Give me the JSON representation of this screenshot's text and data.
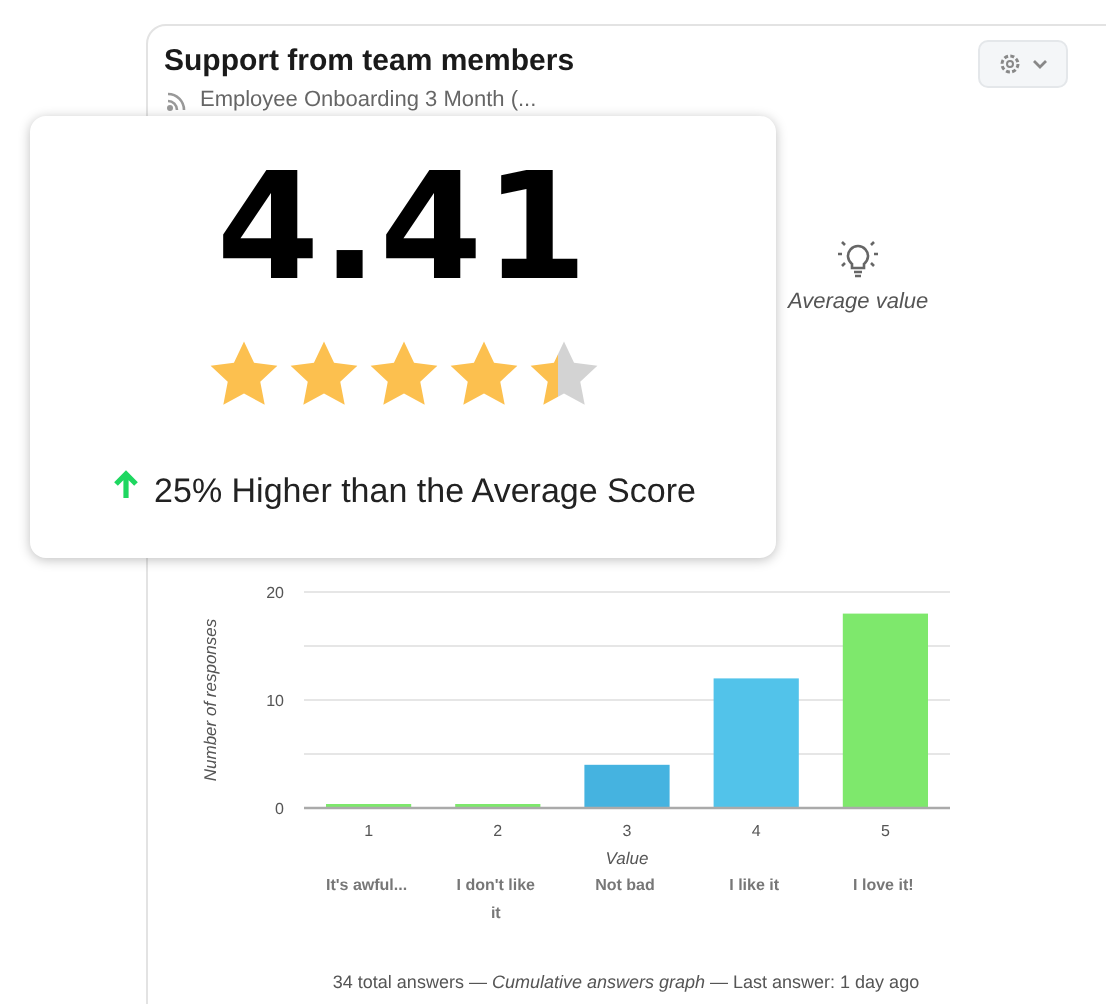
{
  "widget": {
    "title": "Support from team members",
    "source": "Employee Onboarding 3 Month (...",
    "average_label": "Average value"
  },
  "score": {
    "value": "4.41",
    "stars": 4.41,
    "higher": true,
    "comparison": "25% Higher than the Average Score"
  },
  "chart": {
    "chart_data": {
      "type": "bar",
      "xlabel": "Value",
      "ylabel": "Number of responses",
      "categories": [
        "1",
        "2",
        "3",
        "4",
        "5"
      ],
      "series": [
        {
          "color": "#7ee86c",
          "values": [
            0,
            0,
            null,
            null,
            18
          ]
        },
        {
          "color": "#45b3e0",
          "values": [
            null,
            null,
            4,
            null,
            null
          ]
        },
        {
          "color": "#52c3ea",
          "values": [
            null,
            null,
            null,
            12,
            null
          ]
        }
      ],
      "ylim": [
        0,
        20
      ],
      "yticks": [
        0,
        10,
        20
      ]
    },
    "answer_labels": [
      "It's awful...",
      "I don't like it",
      "Not bad",
      "I like it",
      "I love it!"
    ],
    "footer": "34 total answers — *Cumulative answers graph* — Last answer: 1 day ago"
  }
}
